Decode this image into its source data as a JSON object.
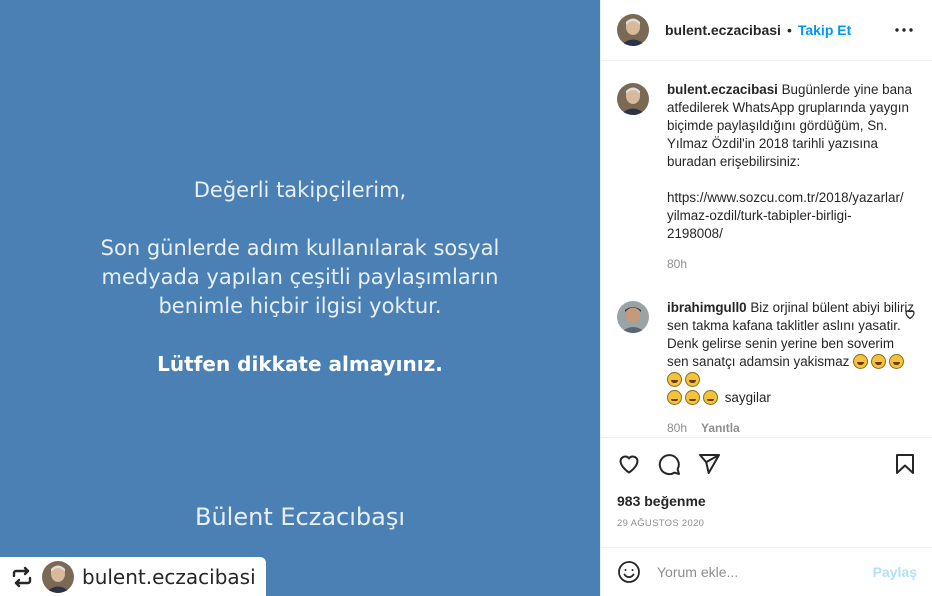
{
  "post_image": {
    "greeting": "Değerli takipçilerim,",
    "body_lines": [
      "Son günlerde adım kullanılarak sosyal",
      "medyada yapılan çeşitli paylaşımların",
      "benimle hiçbir ilgisi yoktur."
    ],
    "emphasis": "Lütfen dikkate almayınız.",
    "signature": "Bülent Eczacıbaşı",
    "background_color": "#4a80b4"
  },
  "repost_badge": {
    "icon": "repost-icon",
    "username": "bulent.eczacibasi"
  },
  "header": {
    "username": "bulent.eczacibasi",
    "separator": "•",
    "follow_label": "Takip Et",
    "more_icon": "more-horizontal-icon"
  },
  "caption": {
    "username": "bulent.eczacibasi",
    "text": "Bugünlerde yine bana atfedilerek WhatsApp gruplarında yaygın biçimde paylaşıldığını gördüğüm, Sn. Yılmaz Özdil'in 2018 tarihli yazısına buradan erişebilirsiniz:",
    "link_lines": [
      "https://www.sozcu.com.tr/2018/yazarlar/",
      "yilmaz-ozdil/turk-tabipler-birligi-",
      "2198008/"
    ],
    "time": "80h"
  },
  "comments": [
    {
      "username": "ibrahimgull0",
      "text": "Biz orjinal bülent abiyi biliriz sen takma kafana taklitler aslını yasatir. Denk gelirse senin yerine ben soverim sen sanatçı adamsin yakismaz",
      "tail": "saygilar",
      "time": "80h",
      "reply_label": "Yanıtla",
      "like_icon": "heart-outline-icon"
    }
  ],
  "actions": {
    "like_icon": "heart-icon",
    "comment_icon": "comment-icon",
    "share_icon": "send-icon",
    "save_icon": "bookmark-icon"
  },
  "likes": "983 beğenme",
  "date": "29 AĞUSTOS 2020",
  "comment_bar": {
    "emoji_icon": "smiley-icon",
    "placeholder": "Yorum ekle...",
    "share_label": "Paylaş"
  },
  "colors": {
    "accent": "#0095f6",
    "muted": "#8e8e8e",
    "share_disabled": "#b2dffc"
  }
}
